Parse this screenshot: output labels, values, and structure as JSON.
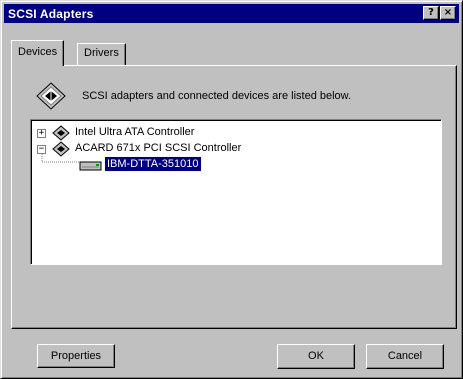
{
  "window": {
    "title": "SCSI Adapters",
    "help_button": "?",
    "close_button": "×"
  },
  "tabs": [
    {
      "label": "Devices",
      "active": true
    },
    {
      "label": "Drivers",
      "active": false
    }
  ],
  "devices_tab": {
    "description": "SCSI adapters and connected devices are listed below.",
    "tree": [
      {
        "label": "Intel Ultra ATA Controller",
        "expander": "+",
        "icon": "scsi-adapter-icon"
      },
      {
        "label": "ACARD 671x PCI SCSI Controller",
        "expander": "−",
        "icon": "scsi-adapter-icon"
      },
      {
        "label": "IBM-DTTA-351010",
        "icon": "hard-disk-icon",
        "selected": true
      }
    ],
    "properties_button": "Properties"
  },
  "footer": {
    "ok_button": "OK",
    "cancel_button": "Cancel"
  },
  "colors": {
    "titlebar": "#000080",
    "face": "#c0c0c0",
    "selection": "#000080"
  }
}
